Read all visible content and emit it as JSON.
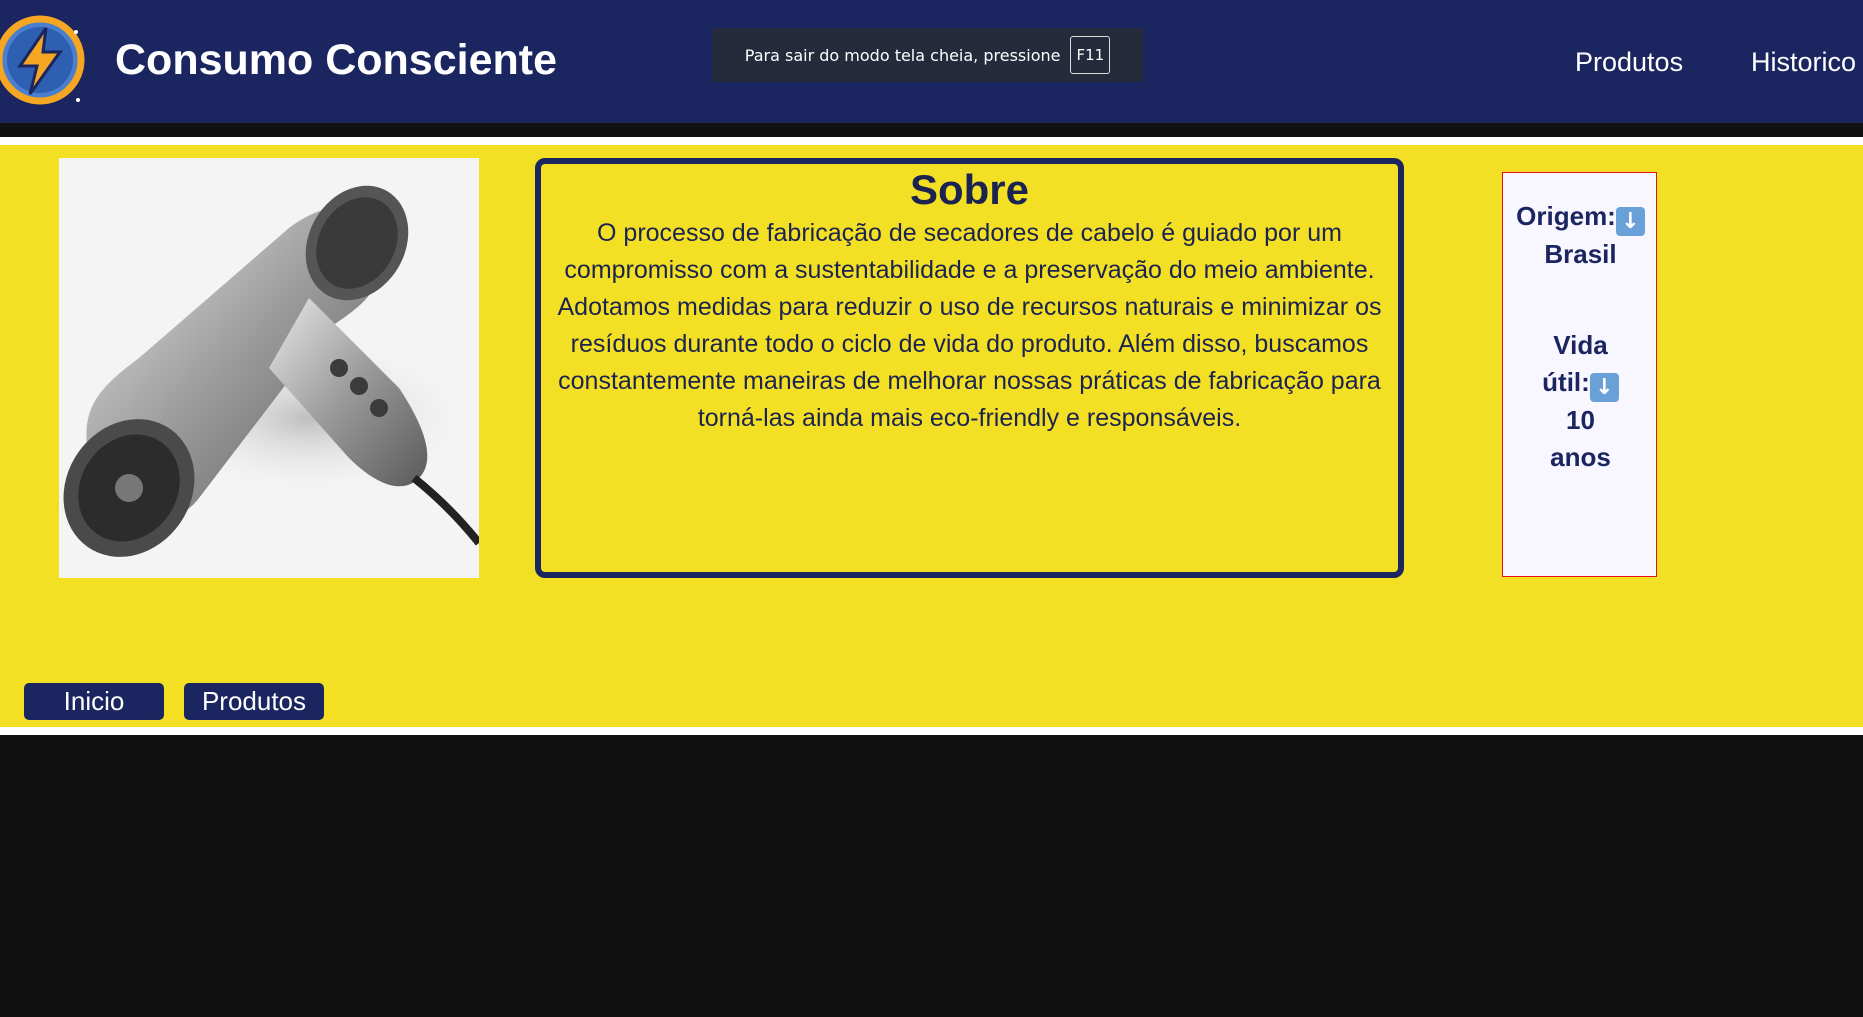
{
  "header": {
    "title": "Consumo Consciente",
    "nav": [
      "Produtos",
      "Historico"
    ]
  },
  "fullscreen_notice": {
    "text": "Para sair do modo tela cheia, pressione",
    "key": "F11"
  },
  "product": {
    "image_icon": "hair-dryer-image",
    "about_title": "Sobre",
    "about_text": "O processo de fabricação de secadores de cabelo é guiado por um compromisso com a sustentabilidade e a preservação do meio ambiente. Adotamos medidas para reduzir o uso de recursos naturais e minimizar os resíduos durante todo o ciclo de vida do produto. Além disso, buscamos constantemente maneiras de melhorar nossas práticas de fabricação para torná-las ainda mais eco-friendly e responsáveis."
  },
  "info": {
    "origin_label": "Origem:",
    "origin_value": "Brasil",
    "life_label_1": "Vida",
    "life_label_2": "útil:",
    "life_value_1": "10",
    "life_value_2": "anos",
    "down_icon": "down-arrow-emoji-icon"
  },
  "buttons": {
    "inicio": "Inicio",
    "produtos": "Produtos"
  },
  "colors": {
    "navy": "#1b2560",
    "yellow": "#f3e024",
    "info_bg": "#f8f6ff",
    "info_border": "#e81010"
  }
}
